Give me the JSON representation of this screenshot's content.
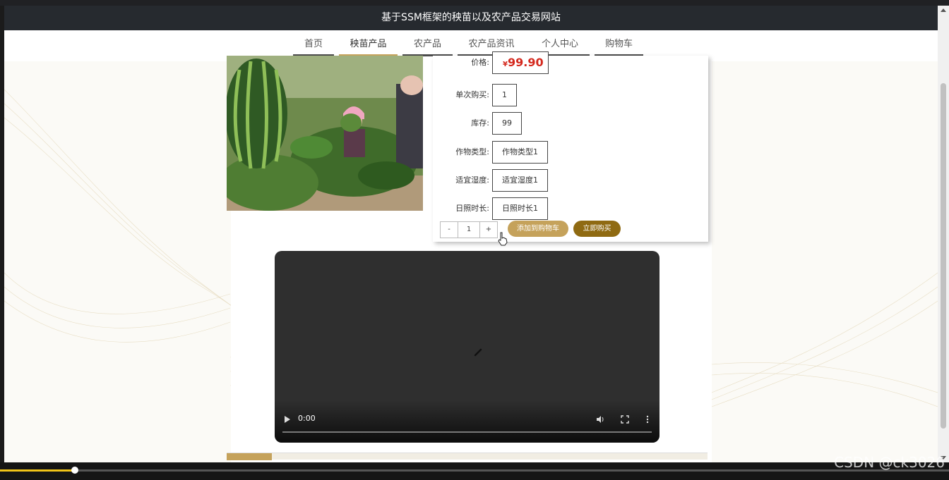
{
  "site": {
    "title": "基于SSM框架的秧苗以及农产品交易网站"
  },
  "nav": {
    "items": [
      {
        "label": "首页"
      },
      {
        "label": "秧苗产品"
      },
      {
        "label": "农产品"
      },
      {
        "label": "农产品资讯"
      },
      {
        "label": "个人中心"
      },
      {
        "label": "购物车"
      }
    ],
    "active_index": 1
  },
  "product": {
    "price_label": "价格:",
    "price_currency": "¥",
    "price_value": "99.90",
    "per_buy_label": "单次购买:",
    "per_buy_value": "1",
    "stock_label": "库存:",
    "stock_value": "99",
    "crop_type_label": "作物类型:",
    "crop_type_value": "作物类型1",
    "humidity_label": "适宜湿度:",
    "humidity_value": "适宜湿度1",
    "sunlight_label": "日照时长:",
    "sunlight_value": "日照时长1"
  },
  "quantity": {
    "minus": "-",
    "value": "1",
    "plus": "+"
  },
  "buttons": {
    "add_to_cart": "添加到购物车",
    "buy_now": "立即购买"
  },
  "video": {
    "time": "0:00"
  },
  "watermark": "CSDN @ck3026",
  "colors": {
    "accent": "#c5a25b",
    "buy": "#8f6a12",
    "price": "#d4281d",
    "header": "#262a2f"
  }
}
